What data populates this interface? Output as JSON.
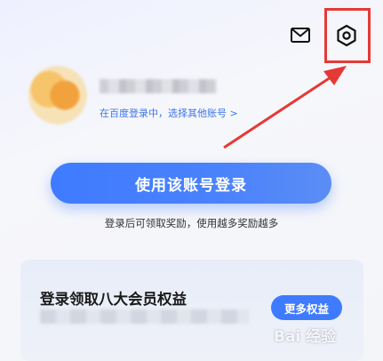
{
  "header": {
    "mail_icon": "mail-icon",
    "settings_icon": "settings-hexagon-icon"
  },
  "profile": {
    "switch_text": "在百度登录中，选择其他账号 >"
  },
  "login": {
    "button_label": "使用该账号登录",
    "tip": "登录后可领取奖励，使用越多奖励越多"
  },
  "benefits_card": {
    "title": "登录领取八大会员权益",
    "more_button": "更多权益"
  },
  "watermark": "Bai 经验",
  "colors": {
    "accent": "#3f7bff",
    "highlight": "#e53935",
    "link": "#3d74e8"
  }
}
